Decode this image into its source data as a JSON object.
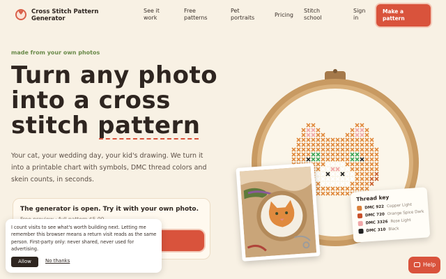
{
  "nav": {
    "brand": "Cross Stitch Pattern Generator",
    "links": [
      "See it work",
      "Free patterns",
      "Pet portraits",
      "Pricing",
      "Stitch school",
      "Sign in"
    ],
    "cta": "Make a pattern"
  },
  "hero": {
    "eyebrow": "made from your own photos",
    "headline_1": "Turn any photo",
    "headline_2": "into a cross",
    "headline_3a": "stitch",
    "headline_3b": "pattern",
    "subcopy": "Your cat, your wedding day, your kid's drawing. We turn it into a printable chart with symbols, DMC thread colors and skein counts, in seconds."
  },
  "generator": {
    "title": "The generator is open. Try it with your own photo.",
    "meta": "Free preview · full pattern $5.99"
  },
  "cookie": {
    "text": "I count visits to see what's worth building next. Letting me remember this browser means a return visit reads as the same person. First-party only: never shared, never used for advertising.",
    "allow": "Allow",
    "deny": "No thanks"
  },
  "thread_key": {
    "title": "Thread key",
    "rows": [
      {
        "code": "DMC 922",
        "name": "Copper Light",
        "color": "#d9803a"
      },
      {
        "code": "DMC 720",
        "name": "Orange Spice Dark",
        "color": "#c8502a"
      },
      {
        "code": "DMC 3326",
        "name": "Rose Light",
        "color": "#f0a7a8"
      },
      {
        "code": "DMC 310",
        "name": "Black",
        "color": "#222222"
      }
    ]
  },
  "help": "Help",
  "colors": {
    "accent": "#d9533c",
    "background": "#f8f1e4",
    "eyebrow": "#6a8a4a",
    "hoop": "#c89a62"
  }
}
